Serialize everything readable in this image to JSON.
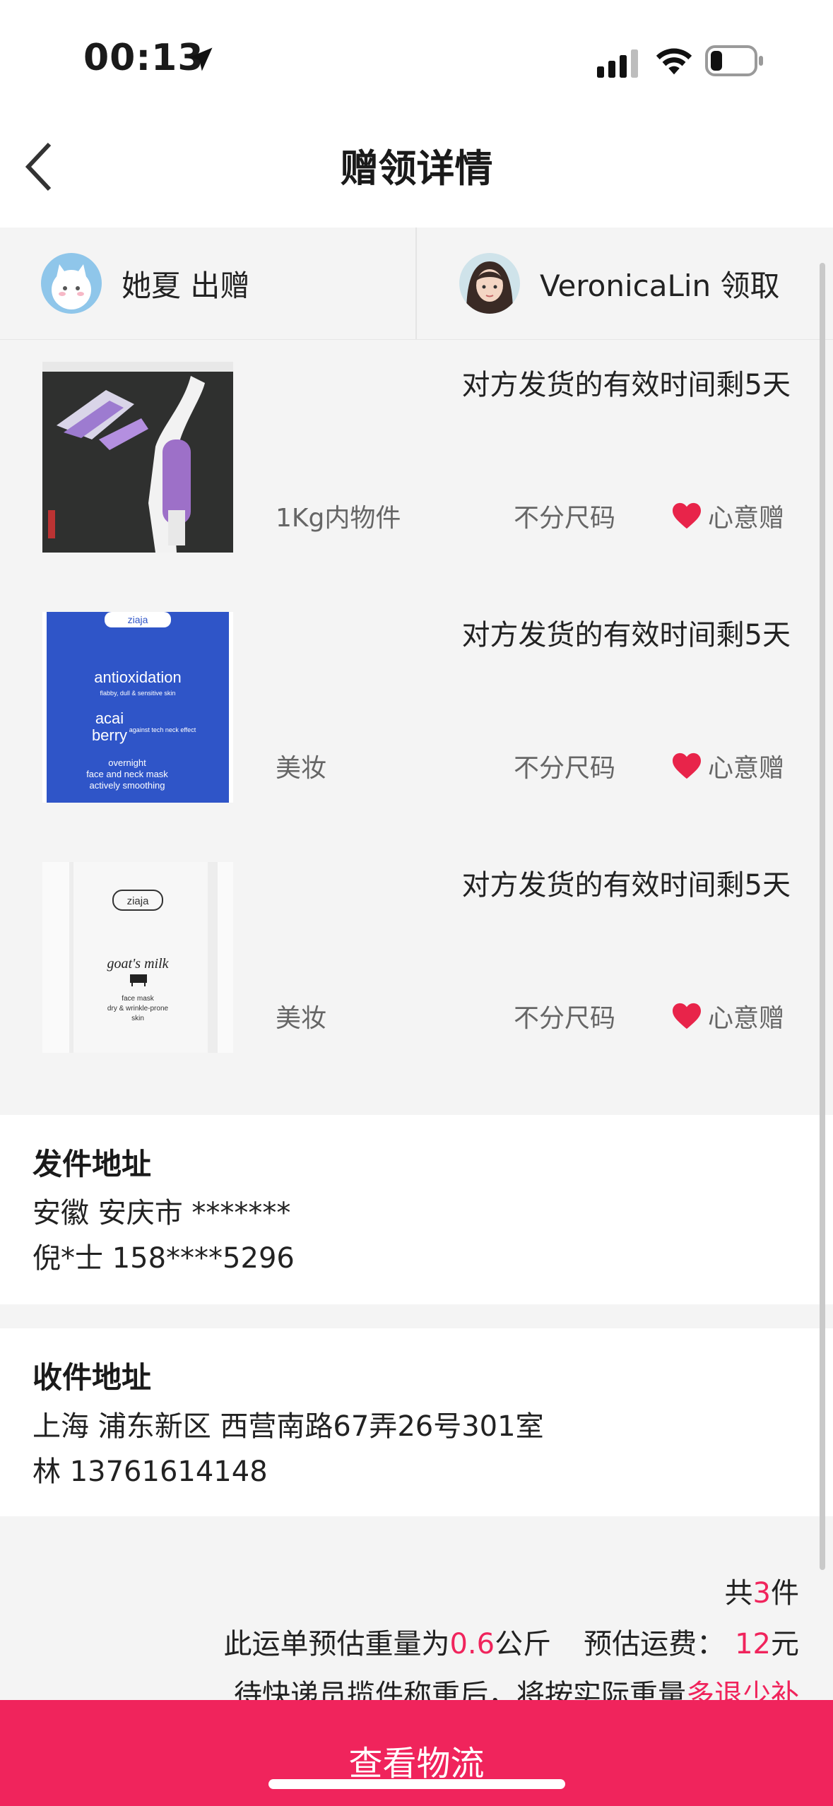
{
  "status_bar": {
    "time": "00:13"
  },
  "nav": {
    "title": "赠领详情",
    "back_icon": "chevron-left-icon"
  },
  "users": {
    "giver": {
      "name_action": "她夏 出赠"
    },
    "receiver": {
      "name_action": "VeronicaLin 领取"
    }
  },
  "items": [
    {
      "remaining": "对方发货的有效时间剩5天",
      "category": "1Kg内物件",
      "size": "不分尺码",
      "gift_type": "心意赠",
      "thumb": "purple-lamp-clip-photo"
    },
    {
      "remaining": "对方发货的有效时间剩5天",
      "category": "美妆",
      "size": "不分尺码",
      "gift_type": "心意赠",
      "thumb": "blue-face-mask-photo",
      "thumb_text": {
        "brand": "ziaja",
        "line1": "antioxidation",
        "line2": "flabby, dull & sensitive skin",
        "line3": "acai",
        "line4": "berry",
        "line5": "against tech neck effect",
        "line6": "overnight",
        "line7": "face and neck mask",
        "line8": "actively smoothing"
      }
    },
    {
      "remaining": "对方发货的有效时间剩5天",
      "category": "美妆",
      "size": "不分尺码",
      "gift_type": "心意赠",
      "thumb": "white-face-mask-photo",
      "thumb_text": {
        "brand": "ziaja",
        "line1": "goat's milk",
        "line2": "face mask",
        "line3": "dry & wrinkle-prone",
        "line4": "skin"
      }
    }
  ],
  "sender_address": {
    "title": "发件地址",
    "line1": "安徽 安庆市 *******",
    "line2": "倪*士 158****5296"
  },
  "receiver_address": {
    "title": "收件地址",
    "line1": "上海 浦东新区 西营南路67弄26号301室",
    "line2": "林 13761614148"
  },
  "summary": {
    "count_prefix": "共",
    "count": "3",
    "count_suffix": "件",
    "weight_prefix": "此运单预估重量为",
    "weight": "0.6",
    "weight_suffix": "公斤",
    "fee_prefix": "预估运费：",
    "fee": "12",
    "fee_suffix": "元",
    "note_prefix": "待快递员揽件称重后，将按实际重量",
    "note_highlight": "多退少补"
  },
  "bottom_button": {
    "label": "查看物流"
  },
  "colors": {
    "accent": "#f0245c",
    "heart": "#e8244a"
  }
}
